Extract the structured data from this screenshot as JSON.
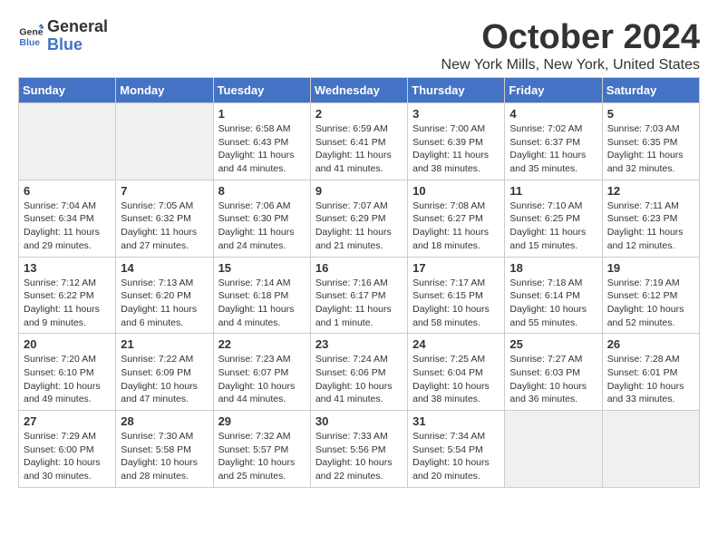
{
  "logo": {
    "general": "General",
    "blue": "Blue"
  },
  "title": "October 2024",
  "location": "New York Mills, New York, United States",
  "weekdays": [
    "Sunday",
    "Monday",
    "Tuesday",
    "Wednesday",
    "Thursday",
    "Friday",
    "Saturday"
  ],
  "weeks": [
    [
      {
        "day": null
      },
      {
        "day": null
      },
      {
        "day": 1,
        "sunrise": "6:58 AM",
        "sunset": "6:43 PM",
        "daylight": "11 hours and 44 minutes."
      },
      {
        "day": 2,
        "sunrise": "6:59 AM",
        "sunset": "6:41 PM",
        "daylight": "11 hours and 41 minutes."
      },
      {
        "day": 3,
        "sunrise": "7:00 AM",
        "sunset": "6:39 PM",
        "daylight": "11 hours and 38 minutes."
      },
      {
        "day": 4,
        "sunrise": "7:02 AM",
        "sunset": "6:37 PM",
        "daylight": "11 hours and 35 minutes."
      },
      {
        "day": 5,
        "sunrise": "7:03 AM",
        "sunset": "6:35 PM",
        "daylight": "11 hours and 32 minutes."
      }
    ],
    [
      {
        "day": 6,
        "sunrise": "7:04 AM",
        "sunset": "6:34 PM",
        "daylight": "11 hours and 29 minutes."
      },
      {
        "day": 7,
        "sunrise": "7:05 AM",
        "sunset": "6:32 PM",
        "daylight": "11 hours and 27 minutes."
      },
      {
        "day": 8,
        "sunrise": "7:06 AM",
        "sunset": "6:30 PM",
        "daylight": "11 hours and 24 minutes."
      },
      {
        "day": 9,
        "sunrise": "7:07 AM",
        "sunset": "6:29 PM",
        "daylight": "11 hours and 21 minutes."
      },
      {
        "day": 10,
        "sunrise": "7:08 AM",
        "sunset": "6:27 PM",
        "daylight": "11 hours and 18 minutes."
      },
      {
        "day": 11,
        "sunrise": "7:10 AM",
        "sunset": "6:25 PM",
        "daylight": "11 hours and 15 minutes."
      },
      {
        "day": 12,
        "sunrise": "7:11 AM",
        "sunset": "6:23 PM",
        "daylight": "11 hours and 12 minutes."
      }
    ],
    [
      {
        "day": 13,
        "sunrise": "7:12 AM",
        "sunset": "6:22 PM",
        "daylight": "11 hours and 9 minutes."
      },
      {
        "day": 14,
        "sunrise": "7:13 AM",
        "sunset": "6:20 PM",
        "daylight": "11 hours and 6 minutes."
      },
      {
        "day": 15,
        "sunrise": "7:14 AM",
        "sunset": "6:18 PM",
        "daylight": "11 hours and 4 minutes."
      },
      {
        "day": 16,
        "sunrise": "7:16 AM",
        "sunset": "6:17 PM",
        "daylight": "11 hours and 1 minute."
      },
      {
        "day": 17,
        "sunrise": "7:17 AM",
        "sunset": "6:15 PM",
        "daylight": "10 hours and 58 minutes."
      },
      {
        "day": 18,
        "sunrise": "7:18 AM",
        "sunset": "6:14 PM",
        "daylight": "10 hours and 55 minutes."
      },
      {
        "day": 19,
        "sunrise": "7:19 AM",
        "sunset": "6:12 PM",
        "daylight": "10 hours and 52 minutes."
      }
    ],
    [
      {
        "day": 20,
        "sunrise": "7:20 AM",
        "sunset": "6:10 PM",
        "daylight": "10 hours and 49 minutes."
      },
      {
        "day": 21,
        "sunrise": "7:22 AM",
        "sunset": "6:09 PM",
        "daylight": "10 hours and 47 minutes."
      },
      {
        "day": 22,
        "sunrise": "7:23 AM",
        "sunset": "6:07 PM",
        "daylight": "10 hours and 44 minutes."
      },
      {
        "day": 23,
        "sunrise": "7:24 AM",
        "sunset": "6:06 PM",
        "daylight": "10 hours and 41 minutes."
      },
      {
        "day": 24,
        "sunrise": "7:25 AM",
        "sunset": "6:04 PM",
        "daylight": "10 hours and 38 minutes."
      },
      {
        "day": 25,
        "sunrise": "7:27 AM",
        "sunset": "6:03 PM",
        "daylight": "10 hours and 36 minutes."
      },
      {
        "day": 26,
        "sunrise": "7:28 AM",
        "sunset": "6:01 PM",
        "daylight": "10 hours and 33 minutes."
      }
    ],
    [
      {
        "day": 27,
        "sunrise": "7:29 AM",
        "sunset": "6:00 PM",
        "daylight": "10 hours and 30 minutes."
      },
      {
        "day": 28,
        "sunrise": "7:30 AM",
        "sunset": "5:58 PM",
        "daylight": "10 hours and 28 minutes."
      },
      {
        "day": 29,
        "sunrise": "7:32 AM",
        "sunset": "5:57 PM",
        "daylight": "10 hours and 25 minutes."
      },
      {
        "day": 30,
        "sunrise": "7:33 AM",
        "sunset": "5:56 PM",
        "daylight": "10 hours and 22 minutes."
      },
      {
        "day": 31,
        "sunrise": "7:34 AM",
        "sunset": "5:54 PM",
        "daylight": "10 hours and 20 minutes."
      },
      {
        "day": null
      },
      {
        "day": null
      }
    ]
  ],
  "labels": {
    "sunrise": "Sunrise:",
    "sunset": "Sunset:",
    "daylight": "Daylight:"
  }
}
